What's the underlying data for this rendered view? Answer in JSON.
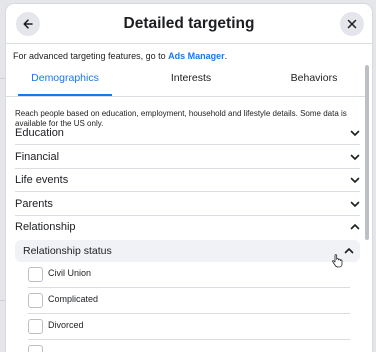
{
  "dialog": {
    "title": "Detailed targeting",
    "back_icon": "arrow-left-icon",
    "close_icon": "close-icon"
  },
  "info": {
    "text": "For advanced targeting features, go to ",
    "link": "Ads Manager",
    "suffix": "."
  },
  "tabs": [
    {
      "label": "Demographics",
      "active": true
    },
    {
      "label": "Interests",
      "active": false
    },
    {
      "label": "Behaviors",
      "active": false
    }
  ],
  "description": "Reach people based on education, employment, household and lifestyle details. Some data is available for the US only.",
  "categories": [
    {
      "label": "Education",
      "expanded": false
    },
    {
      "label": "Financial",
      "expanded": false
    },
    {
      "label": "Life events",
      "expanded": false
    },
    {
      "label": "Parents",
      "expanded": false
    },
    {
      "label": "Relationship",
      "expanded": true
    }
  ],
  "subcategory": {
    "label": "Relationship status",
    "expanded": true
  },
  "options": [
    {
      "label": "Civil Union",
      "checked": false
    },
    {
      "label": "Complicated",
      "checked": false
    },
    {
      "label": "Divorced",
      "checked": false
    }
  ],
  "colors": {
    "accent": "#1877f2",
    "text": "#1c1e21",
    "divider": "#dadde1"
  }
}
